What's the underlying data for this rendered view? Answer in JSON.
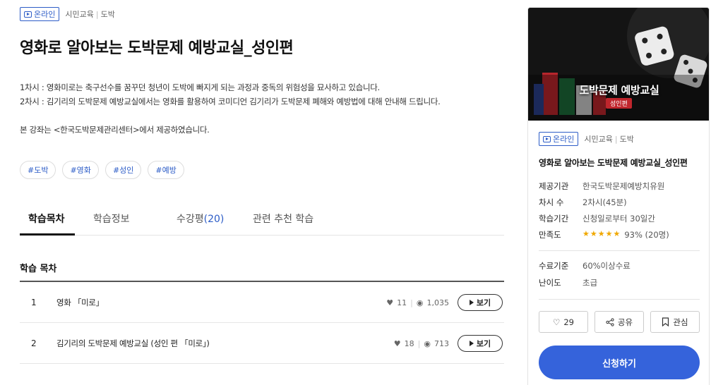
{
  "course": {
    "badge": "온라인",
    "category": "시민교육",
    "subcategory": "도박",
    "title": "영화로 알아보는 도박문제 예방교실_성인편",
    "description": [
      "1차시 : 영화미로는 축구선수를 꿈꾸던 청년이 도박에 빠지게 되는 과정과 중독의 위험성을 묘사하고 있습니다.",
      "2차시 : 김기리의 도박문제 예방교실에서는 영화를 활용하여 코미디언 김기리가 도박문제 폐해와 예방법에 대해 안내해 드립니다."
    ],
    "source_note": "본 강좌는 <한국도박문제관리센터>에서 제공하였습니다.",
    "tags": [
      "#도박",
      "#영화",
      "#성인",
      "#예방"
    ]
  },
  "tabs": [
    {
      "label": "학습목차",
      "count": ""
    },
    {
      "label": "학습정보",
      "count": ""
    },
    {
      "label": "수강평",
      "count": "(20)"
    },
    {
      "label": "관련 추천 학습",
      "count": ""
    }
  ],
  "toc": {
    "title": "학습 목차",
    "view_label": "보기",
    "items": [
      {
        "num": "1",
        "name": "영화 「미로」",
        "likes": "11",
        "views": "1,035"
      },
      {
        "num": "2",
        "name": "김기리의 도박문제 예방교실 (성인 편 「미로」)",
        "likes": "18",
        "views": "713"
      }
    ]
  },
  "sidebar": {
    "thumb_title": "도박문제 예방교실",
    "thumb_subtitle": "성인편",
    "badge": "온라인",
    "category": "시민교육",
    "subcategory": "도박",
    "title": "영화로 알아보는 도박문제 예방교실_성인편",
    "info": [
      {
        "key": "제공기관",
        "value": "한국도박문제예방치유원"
      },
      {
        "key": "차시 수",
        "value": "2차시(45분)"
      },
      {
        "key": "학습기간",
        "value": "신청일로부터 30일간"
      },
      {
        "key": "만족도",
        "value": "93% (20명)",
        "stars": "★★★★★"
      }
    ],
    "completion_key": "수료기준",
    "completion_value": "60%이상수료",
    "difficulty_key": "난이도",
    "difficulty_value": "초급",
    "like_count": "29",
    "share_label": "공유",
    "bookmark_label": "관심",
    "apply_label": "신청하기",
    "accent_color": "#3563db"
  }
}
